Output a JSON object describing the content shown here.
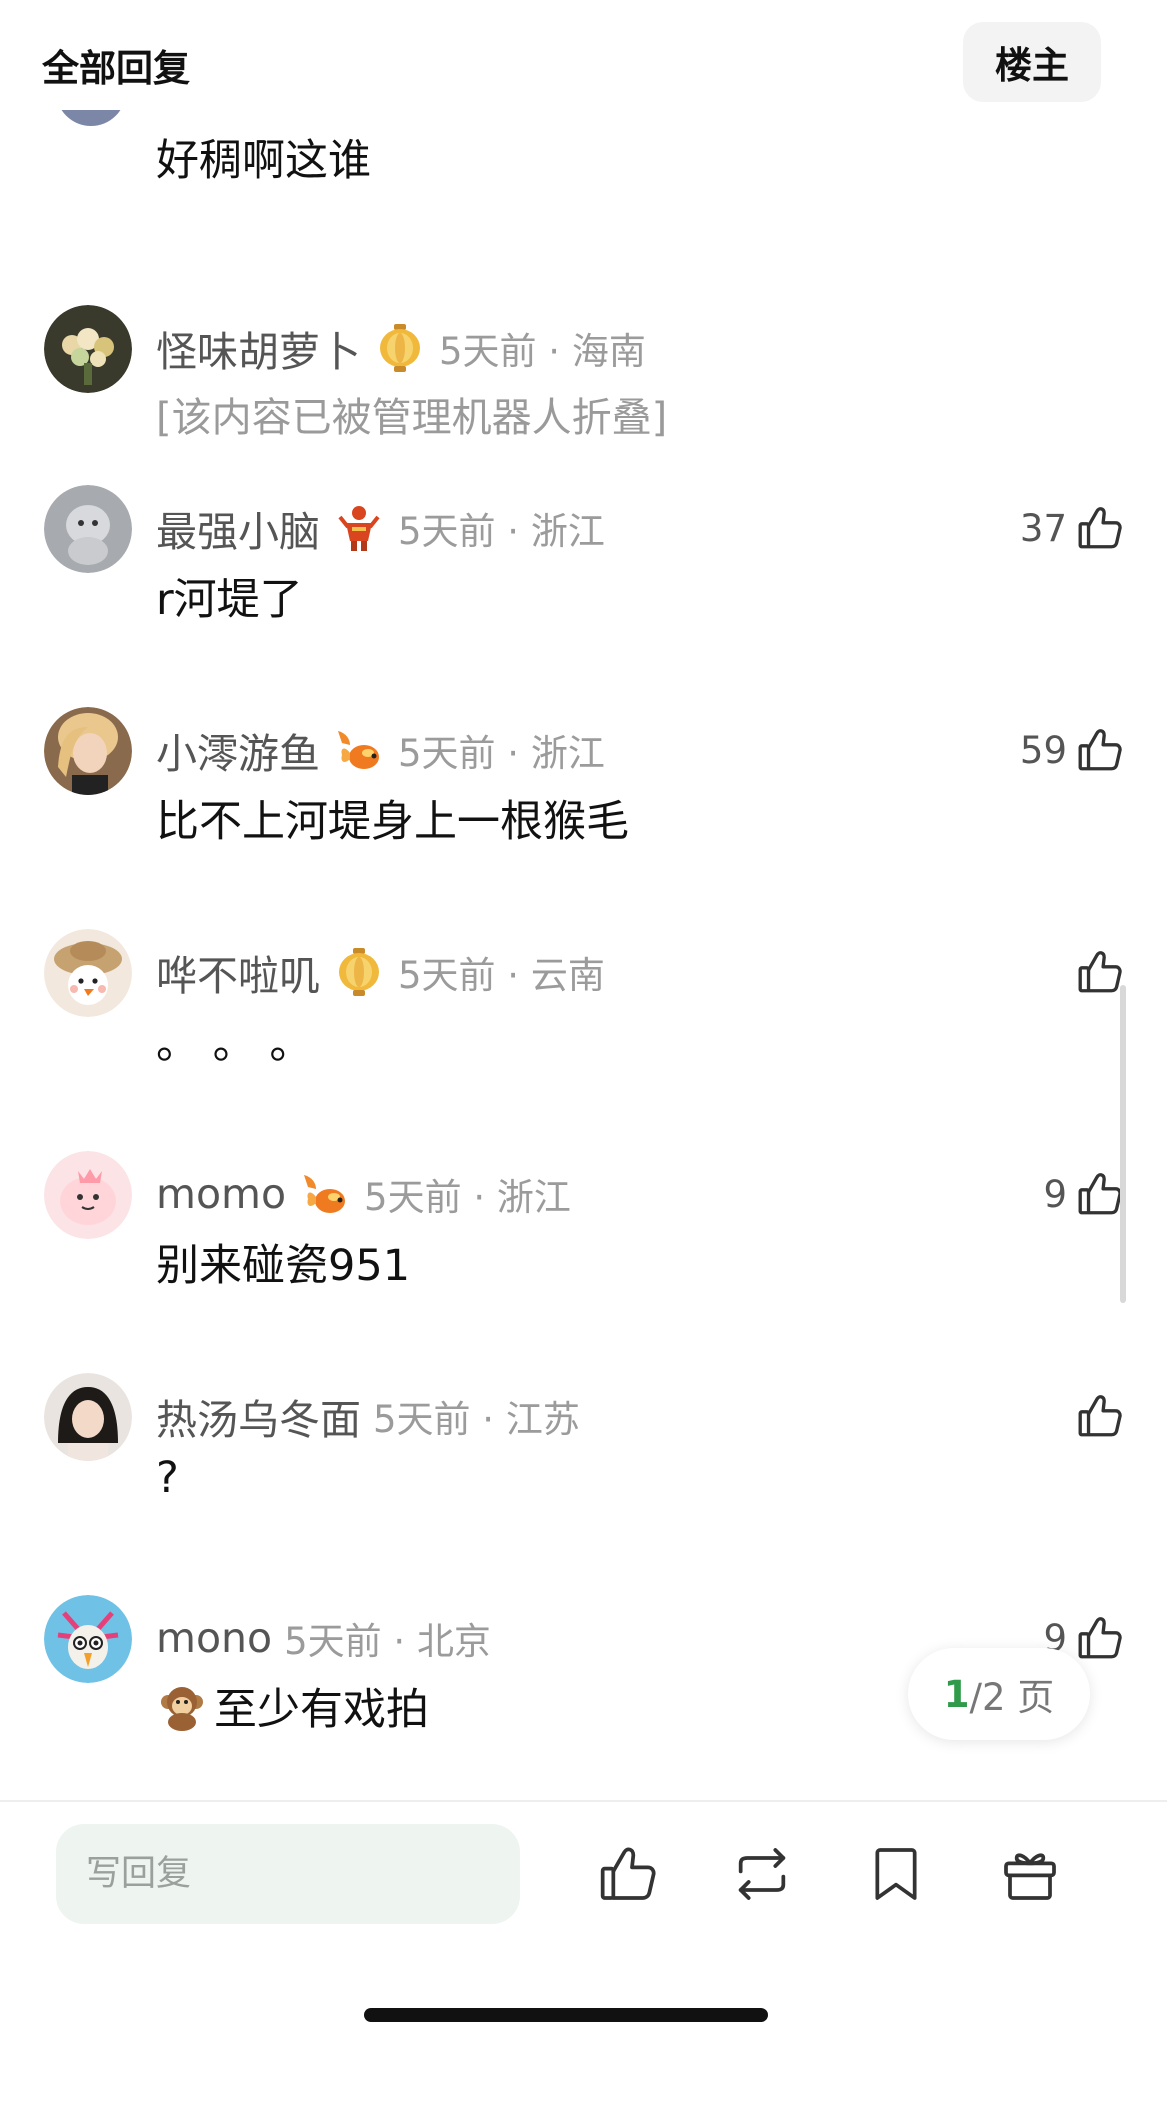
{
  "header": {
    "title": "全部回复",
    "op_label": "楼主"
  },
  "top_partial": {
    "content": "好稠啊这谁"
  },
  "comments": [
    {
      "name": "怪味胡萝卜",
      "badge": "lantern",
      "time": "5天前",
      "location": "海南",
      "text": "[该内容已被管理机器人折叠]",
      "folded": true,
      "likes": ""
    },
    {
      "name": "最强小脑",
      "badge": "figure",
      "time": "5天前",
      "location": "浙江",
      "text": "r河堤了",
      "likes": "37"
    },
    {
      "name": "小澪游鱼",
      "badge": "goldfish",
      "time": "5天前",
      "location": "浙江",
      "text": "比不上河堤身上一根猴毛",
      "likes": "59"
    },
    {
      "name": "哗不啦叽",
      "badge": "lantern",
      "time": "5天前",
      "location": "云南",
      "text": "。 。 。",
      "likes": ""
    },
    {
      "name": "momo",
      "badge": "goldfish",
      "time": "5天前",
      "location": "浙江",
      "text": "别来碰瓷951",
      "likes": "9"
    },
    {
      "name": "热汤乌冬面",
      "badge": "",
      "time": "5天前",
      "location": "江苏",
      "text": "?",
      "likes": ""
    },
    {
      "name": "mono",
      "badge": "",
      "time": "5天前",
      "location": "北京",
      "text": "至少有戏拍",
      "text_emoji": "monkey",
      "likes": "9"
    }
  ],
  "meta_separator": " · ",
  "pager": {
    "current": "1",
    "total_label": "/2 页"
  },
  "bottom_bar": {
    "reply_placeholder": "写回复"
  },
  "colors": {
    "accent_green": "#2e9a4a",
    "input_bg": "#eef4f0",
    "meta_gray": "#9b9b9b"
  },
  "icons": [
    "thumbs-up-icon",
    "repost-icon",
    "bookmark-icon",
    "gift-icon"
  ]
}
